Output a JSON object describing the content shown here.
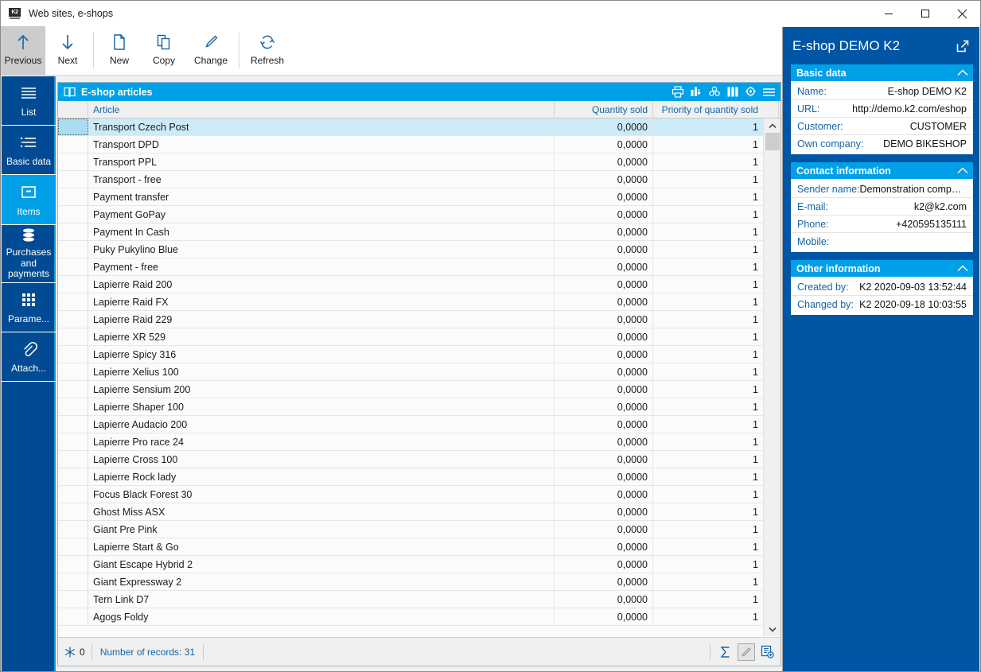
{
  "window": {
    "title": "Web sites, e-shops",
    "icon": "k2-app-icon",
    "buttons": [
      {
        "name": "minimize",
        "glyph": "minimize-icon"
      },
      {
        "name": "maximize",
        "glyph": "maximize-icon"
      },
      {
        "name": "close",
        "glyph": "close-icon"
      }
    ]
  },
  "toolbar": {
    "items": [
      {
        "label": "Previous",
        "icon": "arrow-up-icon",
        "active": true
      },
      {
        "label": "Next",
        "icon": "arrow-down-icon",
        "active": false
      },
      {
        "label": "New",
        "icon": "new-document-icon",
        "active": false
      },
      {
        "label": "Copy",
        "icon": "copy-icon",
        "active": false
      },
      {
        "label": "Change",
        "icon": "pencil-icon",
        "active": false
      },
      {
        "label": "Refresh",
        "icon": "refresh-icon",
        "active": false
      }
    ],
    "right_items": [
      {
        "label": "Print",
        "icon": "printer-icon"
      },
      {
        "label": "Menu",
        "icon": "hamburger-menu-icon"
      }
    ]
  },
  "sidebar": {
    "items": [
      {
        "label": "List",
        "icon": "list-lines-icon",
        "selected": false
      },
      {
        "label": "Basic data",
        "icon": "bullet-list-icon",
        "selected": false
      },
      {
        "label": "Items",
        "icon": "box-icon",
        "selected": true
      },
      {
        "label": "Purchases and payments",
        "icon": "layers-icon",
        "selected": false
      },
      {
        "label": "Parame...",
        "icon": "grid-dots-icon",
        "selected": false
      },
      {
        "label": "Attach...",
        "icon": "paperclip-icon",
        "selected": false
      }
    ]
  },
  "grid": {
    "caption": "E-shop articles",
    "caption_icon": "book-open-icon",
    "caption_tools": [
      "print-icon",
      "bar-chart-icon",
      "group-by-icon",
      "columns-icon",
      "gear-icon",
      "grid-menu-icon"
    ],
    "columns": [
      {
        "key": "article",
        "label": "Article",
        "align": "left"
      },
      {
        "key": "quantity_sold",
        "label": "Quantity sold",
        "align": "right"
      },
      {
        "key": "priority",
        "label": "Priority of quantity sold",
        "align": "right"
      }
    ],
    "rows": [
      {
        "article": "Transport Czech Post",
        "quantity_sold": "0,0000",
        "priority": "1",
        "selected": true
      },
      {
        "article": "Transport DPD",
        "quantity_sold": "0,0000",
        "priority": "1",
        "selected": false
      },
      {
        "article": "Transport PPL",
        "quantity_sold": "0,0000",
        "priority": "1",
        "selected": false
      },
      {
        "article": "Transport - free",
        "quantity_sold": "0,0000",
        "priority": "1",
        "selected": false
      },
      {
        "article": "Payment transfer",
        "quantity_sold": "0,0000",
        "priority": "1",
        "selected": false
      },
      {
        "article": "Payment GoPay",
        "quantity_sold": "0,0000",
        "priority": "1",
        "selected": false
      },
      {
        "article": "Payment In Cash",
        "quantity_sold": "0,0000",
        "priority": "1",
        "selected": false
      },
      {
        "article": "Puky Pukylino Blue",
        "quantity_sold": "0,0000",
        "priority": "1",
        "selected": false
      },
      {
        "article": "Payment - free",
        "quantity_sold": "0,0000",
        "priority": "1",
        "selected": false
      },
      {
        "article": "Lapierre Raid 200",
        "quantity_sold": "0,0000",
        "priority": "1",
        "selected": false
      },
      {
        "article": "Lapierre Raid FX",
        "quantity_sold": "0,0000",
        "priority": "1",
        "selected": false
      },
      {
        "article": "Lapierre Raid 229",
        "quantity_sold": "0,0000",
        "priority": "1",
        "selected": false
      },
      {
        "article": "Lapierre XR 529",
        "quantity_sold": "0,0000",
        "priority": "1",
        "selected": false
      },
      {
        "article": "Lapierre Spicy 316",
        "quantity_sold": "0,0000",
        "priority": "1",
        "selected": false
      },
      {
        "article": "Lapierre Xelius 100",
        "quantity_sold": "0,0000",
        "priority": "1",
        "selected": false
      },
      {
        "article": "Lapierre Sensium 200",
        "quantity_sold": "0,0000",
        "priority": "1",
        "selected": false
      },
      {
        "article": "Lapierre Shaper 100",
        "quantity_sold": "0,0000",
        "priority": "1",
        "selected": false
      },
      {
        "article": "Lapierre Audacio 200",
        "quantity_sold": "0,0000",
        "priority": "1",
        "selected": false
      },
      {
        "article": "Lapierre Pro race 24",
        "quantity_sold": "0,0000",
        "priority": "1",
        "selected": false
      },
      {
        "article": "Lapierre Cross 100",
        "quantity_sold": "0,0000",
        "priority": "1",
        "selected": false
      },
      {
        "article": "Lapierre Rock lady",
        "quantity_sold": "0,0000",
        "priority": "1",
        "selected": false
      },
      {
        "article": "Focus Black Forest 30",
        "quantity_sold": "0,0000",
        "priority": "1",
        "selected": false
      },
      {
        "article": "Ghost Miss ASX",
        "quantity_sold": "0,0000",
        "priority": "1",
        "selected": false
      },
      {
        "article": "Giant Pre Pink",
        "quantity_sold": "0,0000",
        "priority": "1",
        "selected": false
      },
      {
        "article": "Lapierre Start & Go",
        "quantity_sold": "0,0000",
        "priority": "1",
        "selected": false
      },
      {
        "article": "Giant Escape Hybrid 2",
        "quantity_sold": "0,0000",
        "priority": "1",
        "selected": false
      },
      {
        "article": "Giant Expressway 2",
        "quantity_sold": "0,0000",
        "priority": "1",
        "selected": false
      },
      {
        "article": "Tern Link D7",
        "quantity_sold": "0,0000",
        "priority": "1",
        "selected": false
      },
      {
        "article": "Agogs Foldy",
        "quantity_sold": "0,0000",
        "priority": "1",
        "selected": false
      }
    ],
    "status": {
      "marked_icon": "snowflake-icon",
      "marked_count": "0",
      "records_text": "Number of records: 31",
      "tools": [
        {
          "name": "sum-icon",
          "boxed": false
        },
        {
          "name": "edit-pencil-icon",
          "boxed": true
        },
        {
          "name": "add-record-icon",
          "boxed": false
        }
      ]
    }
  },
  "detail": {
    "title": "E-shop DEMO K2",
    "expand_icon": "open-external-icon",
    "sections": [
      {
        "title": "Basic data",
        "rows": [
          {
            "label": "Name:",
            "value": "E-shop DEMO K2"
          },
          {
            "label": "URL:",
            "value": "http://demo.k2.com/eshop"
          },
          {
            "label": "Customer:",
            "value": "CUSTOMER"
          },
          {
            "label": "Own company:",
            "value": "DEMO BIKESHOP"
          }
        ]
      },
      {
        "title": "Contact information",
        "rows": [
          {
            "label": "Sender name:",
            "value": "Demonstration company ..."
          },
          {
            "label": "E-mail:",
            "value": "k2@k2.com"
          },
          {
            "label": "Phone:",
            "value": "+420595135111"
          },
          {
            "label": "Mobile:",
            "value": ""
          }
        ]
      },
      {
        "title": "Other information",
        "rows": [
          {
            "label": "Created by:",
            "value": "K2 2020-09-03 13:52:44"
          },
          {
            "label": "Changed by:",
            "value": "K2 2020-09-18 10:03:55"
          }
        ]
      }
    ]
  },
  "colors": {
    "accent_blue": "#0055a5",
    "accent_cyan": "#00a0e9",
    "nav_blue": "#004b93",
    "link_blue": "#1464a5",
    "row_selected": "#cdeaf7"
  }
}
